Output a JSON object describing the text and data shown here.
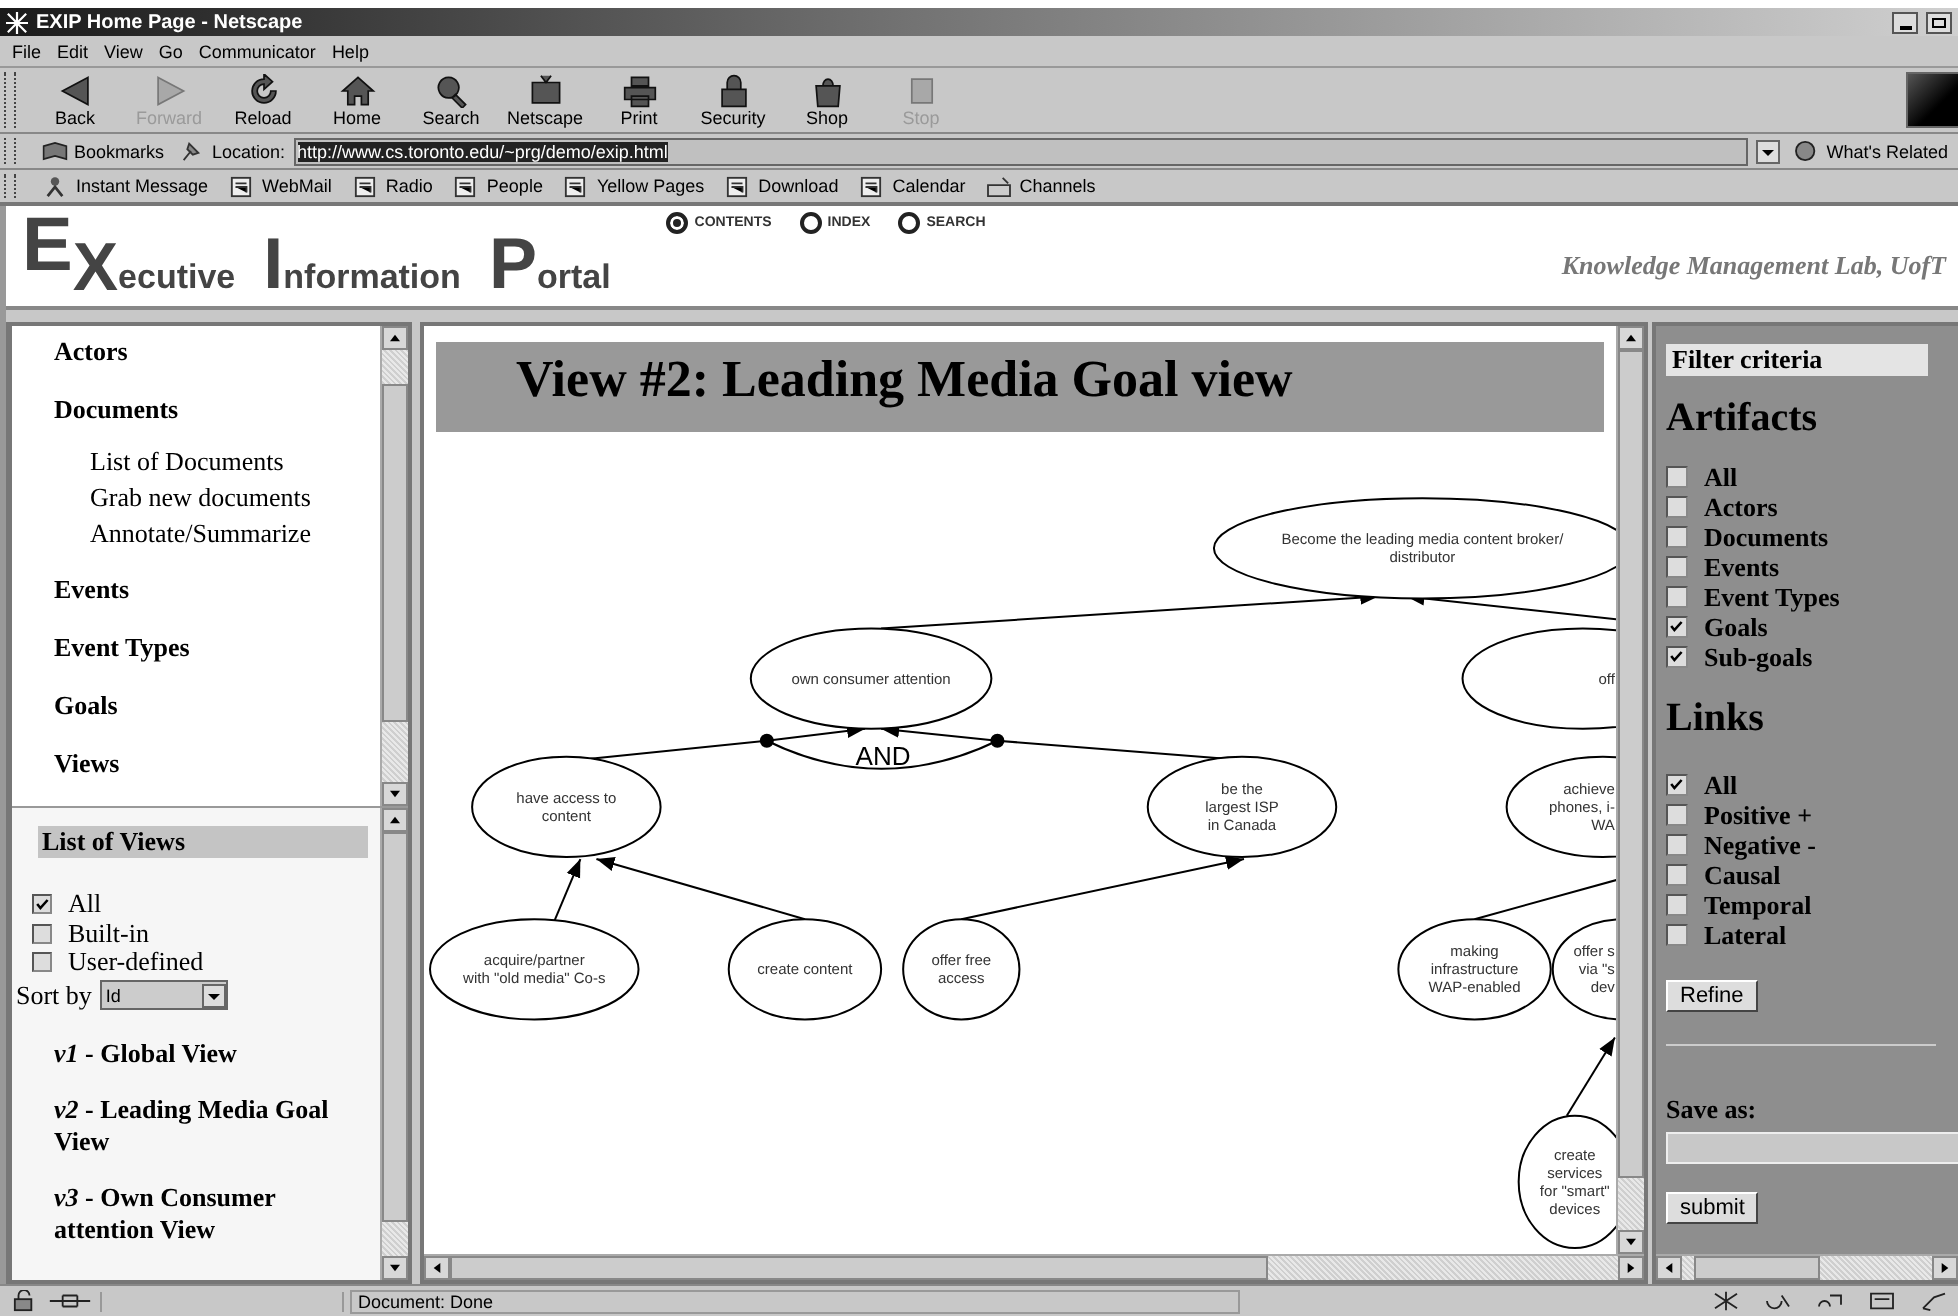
{
  "window": {
    "title": "EXIP Home Page - Netscape"
  },
  "menu": [
    "File",
    "Edit",
    "View",
    "Go",
    "Communicator",
    "Help"
  ],
  "toolbar": [
    {
      "label": "Back",
      "disabled": false
    },
    {
      "label": "Forward",
      "disabled": true
    },
    {
      "label": "Reload",
      "disabled": false
    },
    {
      "label": "Home",
      "disabled": false
    },
    {
      "label": "Search",
      "disabled": false
    },
    {
      "label": "Netscape",
      "disabled": false
    },
    {
      "label": "Print",
      "disabled": false
    },
    {
      "label": "Security",
      "disabled": false
    },
    {
      "label": "Shop",
      "disabled": false
    },
    {
      "label": "Stop",
      "disabled": true
    }
  ],
  "location_bar": {
    "bookmarks": "Bookmarks",
    "label": "Location:",
    "url": "http://www.cs.toronto.edu/~prg/demo/exip.html",
    "related": "What's Related"
  },
  "personal_bar": [
    "Instant Message",
    "WebMail",
    "Radio",
    "People",
    "Yellow Pages",
    "Download",
    "Calendar",
    "Channels"
  ],
  "header": {
    "logo": [
      {
        "text": "E",
        "kind": "high"
      },
      {
        "text": "X",
        "kind": "low"
      },
      {
        "text": "ecutive",
        "kind": "rest"
      },
      {
        "text": "I",
        "kind": "cap"
      },
      {
        "text": "nformation",
        "kind": "rest"
      },
      {
        "text": "P",
        "kind": "cap"
      },
      {
        "text": "ortal",
        "kind": "rest"
      }
    ],
    "nav": [
      {
        "label": "CONTENTS",
        "selected": true
      },
      {
        "label": "INDEX",
        "selected": false
      },
      {
        "label": "SEARCH",
        "selected": false
      }
    ],
    "tagline": "Knowledge Management Lab, UofT"
  },
  "nav_menu": [
    {
      "label": "Actors"
    },
    {
      "label": "Documents",
      "children": [
        {
          "label": "List of Documents"
        },
        {
          "label": "Grab new documents"
        },
        {
          "label": "Annotate/Summarize"
        }
      ]
    },
    {
      "label": "Events"
    },
    {
      "label": "Event Types"
    },
    {
      "label": "Goals"
    },
    {
      "label": "Views"
    }
  ],
  "views_panel": {
    "title": "List of Views",
    "filters": [
      {
        "label": "All",
        "checked": true
      },
      {
        "label": "Built-in",
        "checked": false
      },
      {
        "label": "User-defined",
        "checked": false
      }
    ],
    "sort_label": "Sort by",
    "sort_value": "Id",
    "views": [
      {
        "title": "*v1* - Global View"
      },
      {
        "title": "*v2* - Leading Media Goal View"
      },
      {
        "title": "*v3* - Own Consumer attention View"
      }
    ]
  },
  "diagram": {
    "title": "View #2: Leading Media Goal view",
    "connector": "AND",
    "nodes": [
      {
        "lines": [
          "Become the leading media content broker/",
          "distributor"
        ]
      },
      {
        "lines": [
          "own consumer attention"
        ]
      },
      {
        "lines": [
          "off"
        ]
      },
      {
        "lines": [
          "have access to",
          "content"
        ]
      },
      {
        "lines": [
          "be the",
          "largest ISP",
          "in Canada"
        ]
      },
      {
        "lines": [
          "achieve",
          "phones, i-",
          "WA"
        ]
      },
      {
        "lines": [
          "acquire/partner",
          "with \"old media\" Co-s"
        ]
      },
      {
        "lines": [
          "create content"
        ]
      },
      {
        "lines": [
          "offer free",
          "access"
        ]
      },
      {
        "lines": [
          "making",
          "infrastructure",
          "WAP-enabled"
        ]
      },
      {
        "lines": [
          "offer s",
          "via \"s",
          "dev"
        ]
      },
      {
        "lines": [
          "create",
          "services",
          "for \"smart\"",
          "devices"
        ]
      }
    ]
  },
  "filter_panel": {
    "title": "Filter criteria",
    "artifacts_heading": "Artifacts",
    "artifacts": [
      {
        "label": "All",
        "checked": false
      },
      {
        "label": "Actors",
        "checked": false
      },
      {
        "label": "Documents",
        "checked": false
      },
      {
        "label": "Events",
        "checked": false
      },
      {
        "label": "Event Types",
        "checked": false
      },
      {
        "label": "Goals",
        "checked": true
      },
      {
        "label": "Sub-goals",
        "checked": true
      }
    ],
    "links_heading": "Links",
    "links": [
      {
        "label": "All",
        "checked": true
      },
      {
        "label": "Positive +",
        "checked": false
      },
      {
        "label": "Negative -",
        "checked": false
      },
      {
        "label": "Causal",
        "checked": false
      },
      {
        "label": "Temporal",
        "checked": false
      },
      {
        "label": "Lateral",
        "checked": false
      }
    ],
    "refine": "Refine",
    "save_label": "Save as:",
    "submit": "submit"
  },
  "status_bar": {
    "text": "Document: Done"
  }
}
